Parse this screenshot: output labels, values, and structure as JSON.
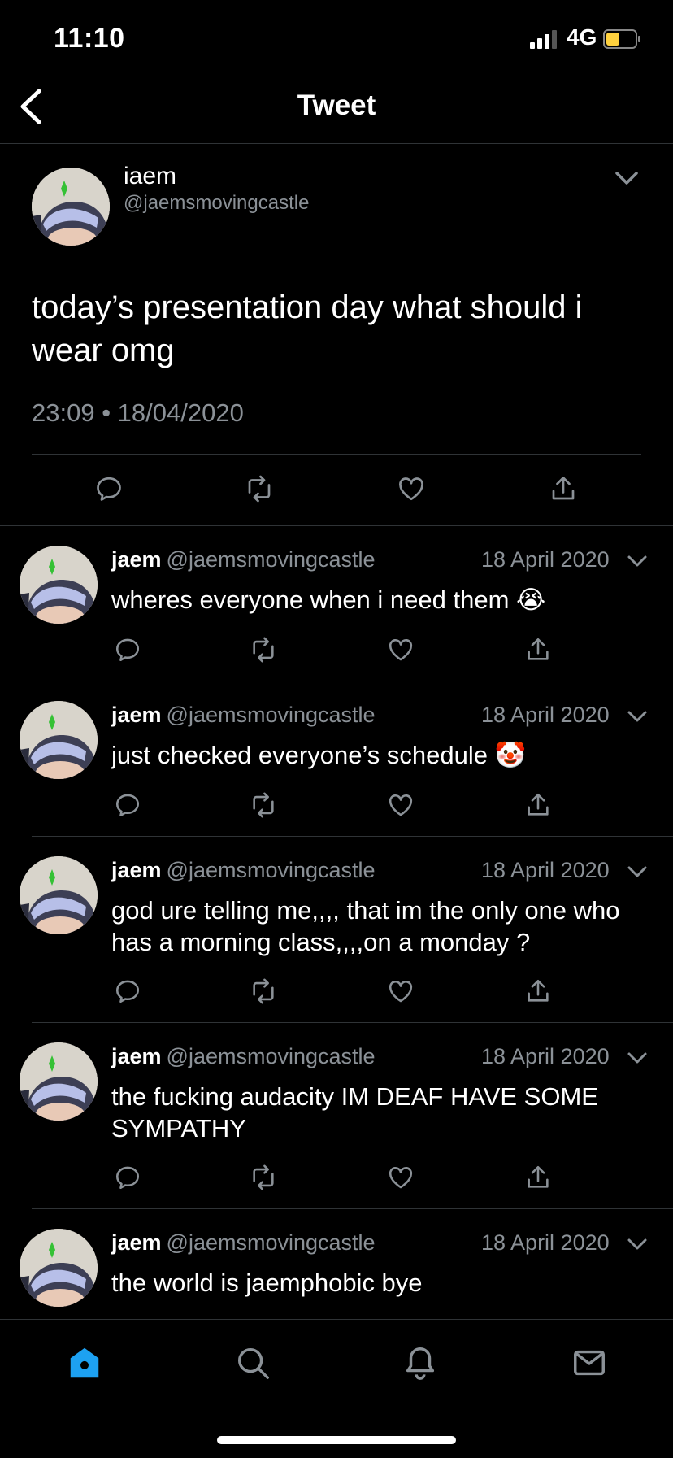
{
  "status": {
    "time": "11:10",
    "network": "4G"
  },
  "nav": {
    "title": "Tweet"
  },
  "main_tweet": {
    "name": "iaem",
    "handle": "@jaemsmovingcastle",
    "text": "today’s presentation day what should i wear omg",
    "timestamp": "23:09 • 18/04/2020"
  },
  "replies": [
    {
      "name": "jaem",
      "handle": "@jaemsmovingcastle",
      "date": "18 April 2020",
      "text": "wheres everyone when i need them 😭"
    },
    {
      "name": "jaem",
      "handle": "@jaemsmovingcastle",
      "date": "18 April 2020",
      "text": "just checked everyone’s schedule 🤡"
    },
    {
      "name": "jaem",
      "handle": "@jaemsmovingcastle",
      "date": "18 April 2020",
      "text": "god ure telling me,,,, that im the only one who has a morning class,,,,on a monday ?"
    },
    {
      "name": "jaem",
      "handle": "@jaemsmovingcastle",
      "date": "18 April 2020",
      "text": "the fucking audacity IM DEAF HAVE SOME SYMPATHY"
    },
    {
      "name": "jaem",
      "handle": "@jaemsmovingcastle",
      "date": "18 April 2020",
      "text": "the world is jaemphobic bye"
    }
  ],
  "colors": {
    "accent": "#1da1f2",
    "background": "#000000",
    "secondary_text": "#8b9197",
    "divider": "#2f3336",
    "battery_fill": "#ffd23f"
  },
  "icons": {
    "actions": [
      "reply-icon",
      "retweet-icon",
      "like-icon",
      "share-icon"
    ],
    "tabs": [
      "home-icon",
      "search-icon",
      "notifications-icon",
      "messages-icon"
    ]
  }
}
